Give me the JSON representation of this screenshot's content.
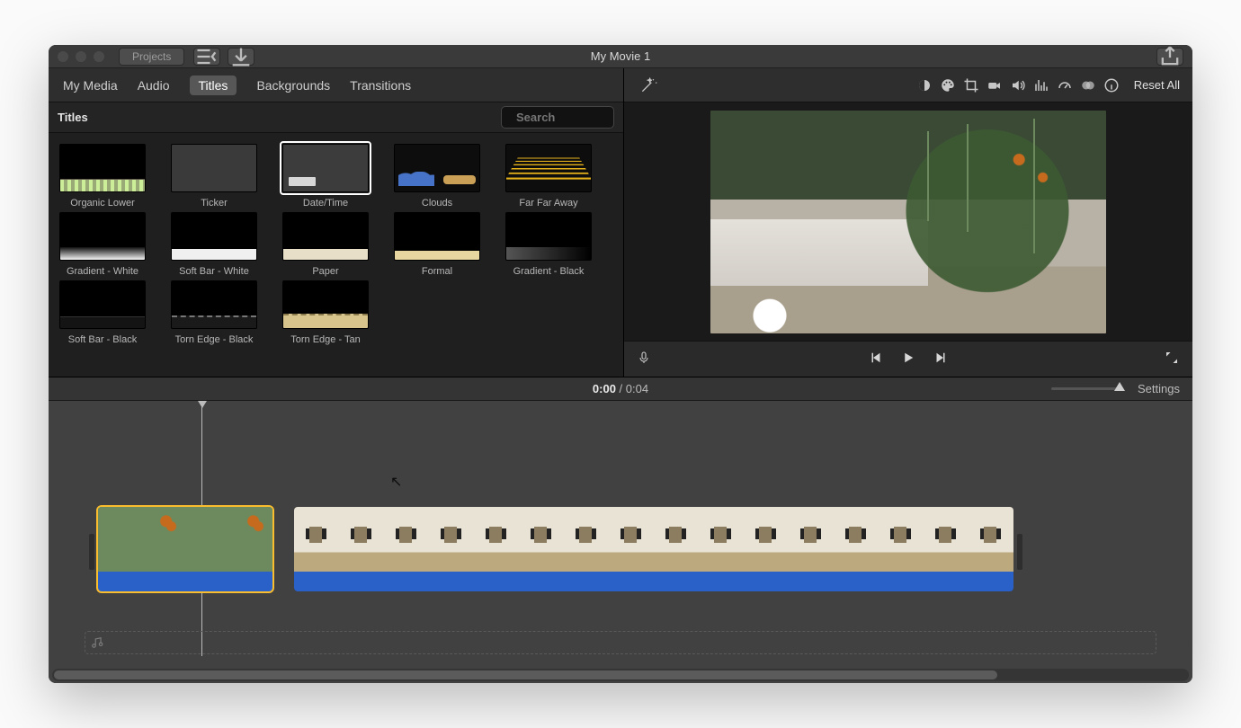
{
  "window_title": "My Movie 1",
  "titlebar": {
    "projects": "Projects"
  },
  "browser_tabs": [
    "My Media",
    "Audio",
    "Titles",
    "Backgrounds",
    "Transitions"
  ],
  "browser_active_index": 2,
  "section_label": "Titles",
  "search_placeholder": "Search",
  "titles": [
    {
      "label": "Organic Lower",
      "thumb": "th-organic"
    },
    {
      "label": "Ticker",
      "thumb": "th-ticker"
    },
    {
      "label": "Date/Time",
      "thumb": "th-datetime",
      "selected": true
    },
    {
      "label": "Clouds",
      "thumb": "th-clouds"
    },
    {
      "label": "Far Far Away",
      "thumb": "th-ffa"
    },
    {
      "label": "Gradient - White",
      "thumb": "th-gw"
    },
    {
      "label": "Soft Bar - White",
      "thumb": "th-sbw"
    },
    {
      "label": "Paper",
      "thumb": "th-paper"
    },
    {
      "label": "Formal",
      "thumb": "th-formal"
    },
    {
      "label": "Gradient - Black",
      "thumb": "th-gb"
    },
    {
      "label": "Soft Bar - Black",
      "thumb": "th-sbb"
    },
    {
      "label": "Torn Edge - Black",
      "thumb": "th-teb"
    },
    {
      "label": "Torn Edge - Tan",
      "thumb": "th-tet"
    }
  ],
  "adjust": {
    "reset": "Reset All"
  },
  "playhead_time": {
    "current": "0:00",
    "sep": " / ",
    "total": "0:04"
  },
  "settings": "Settings"
}
